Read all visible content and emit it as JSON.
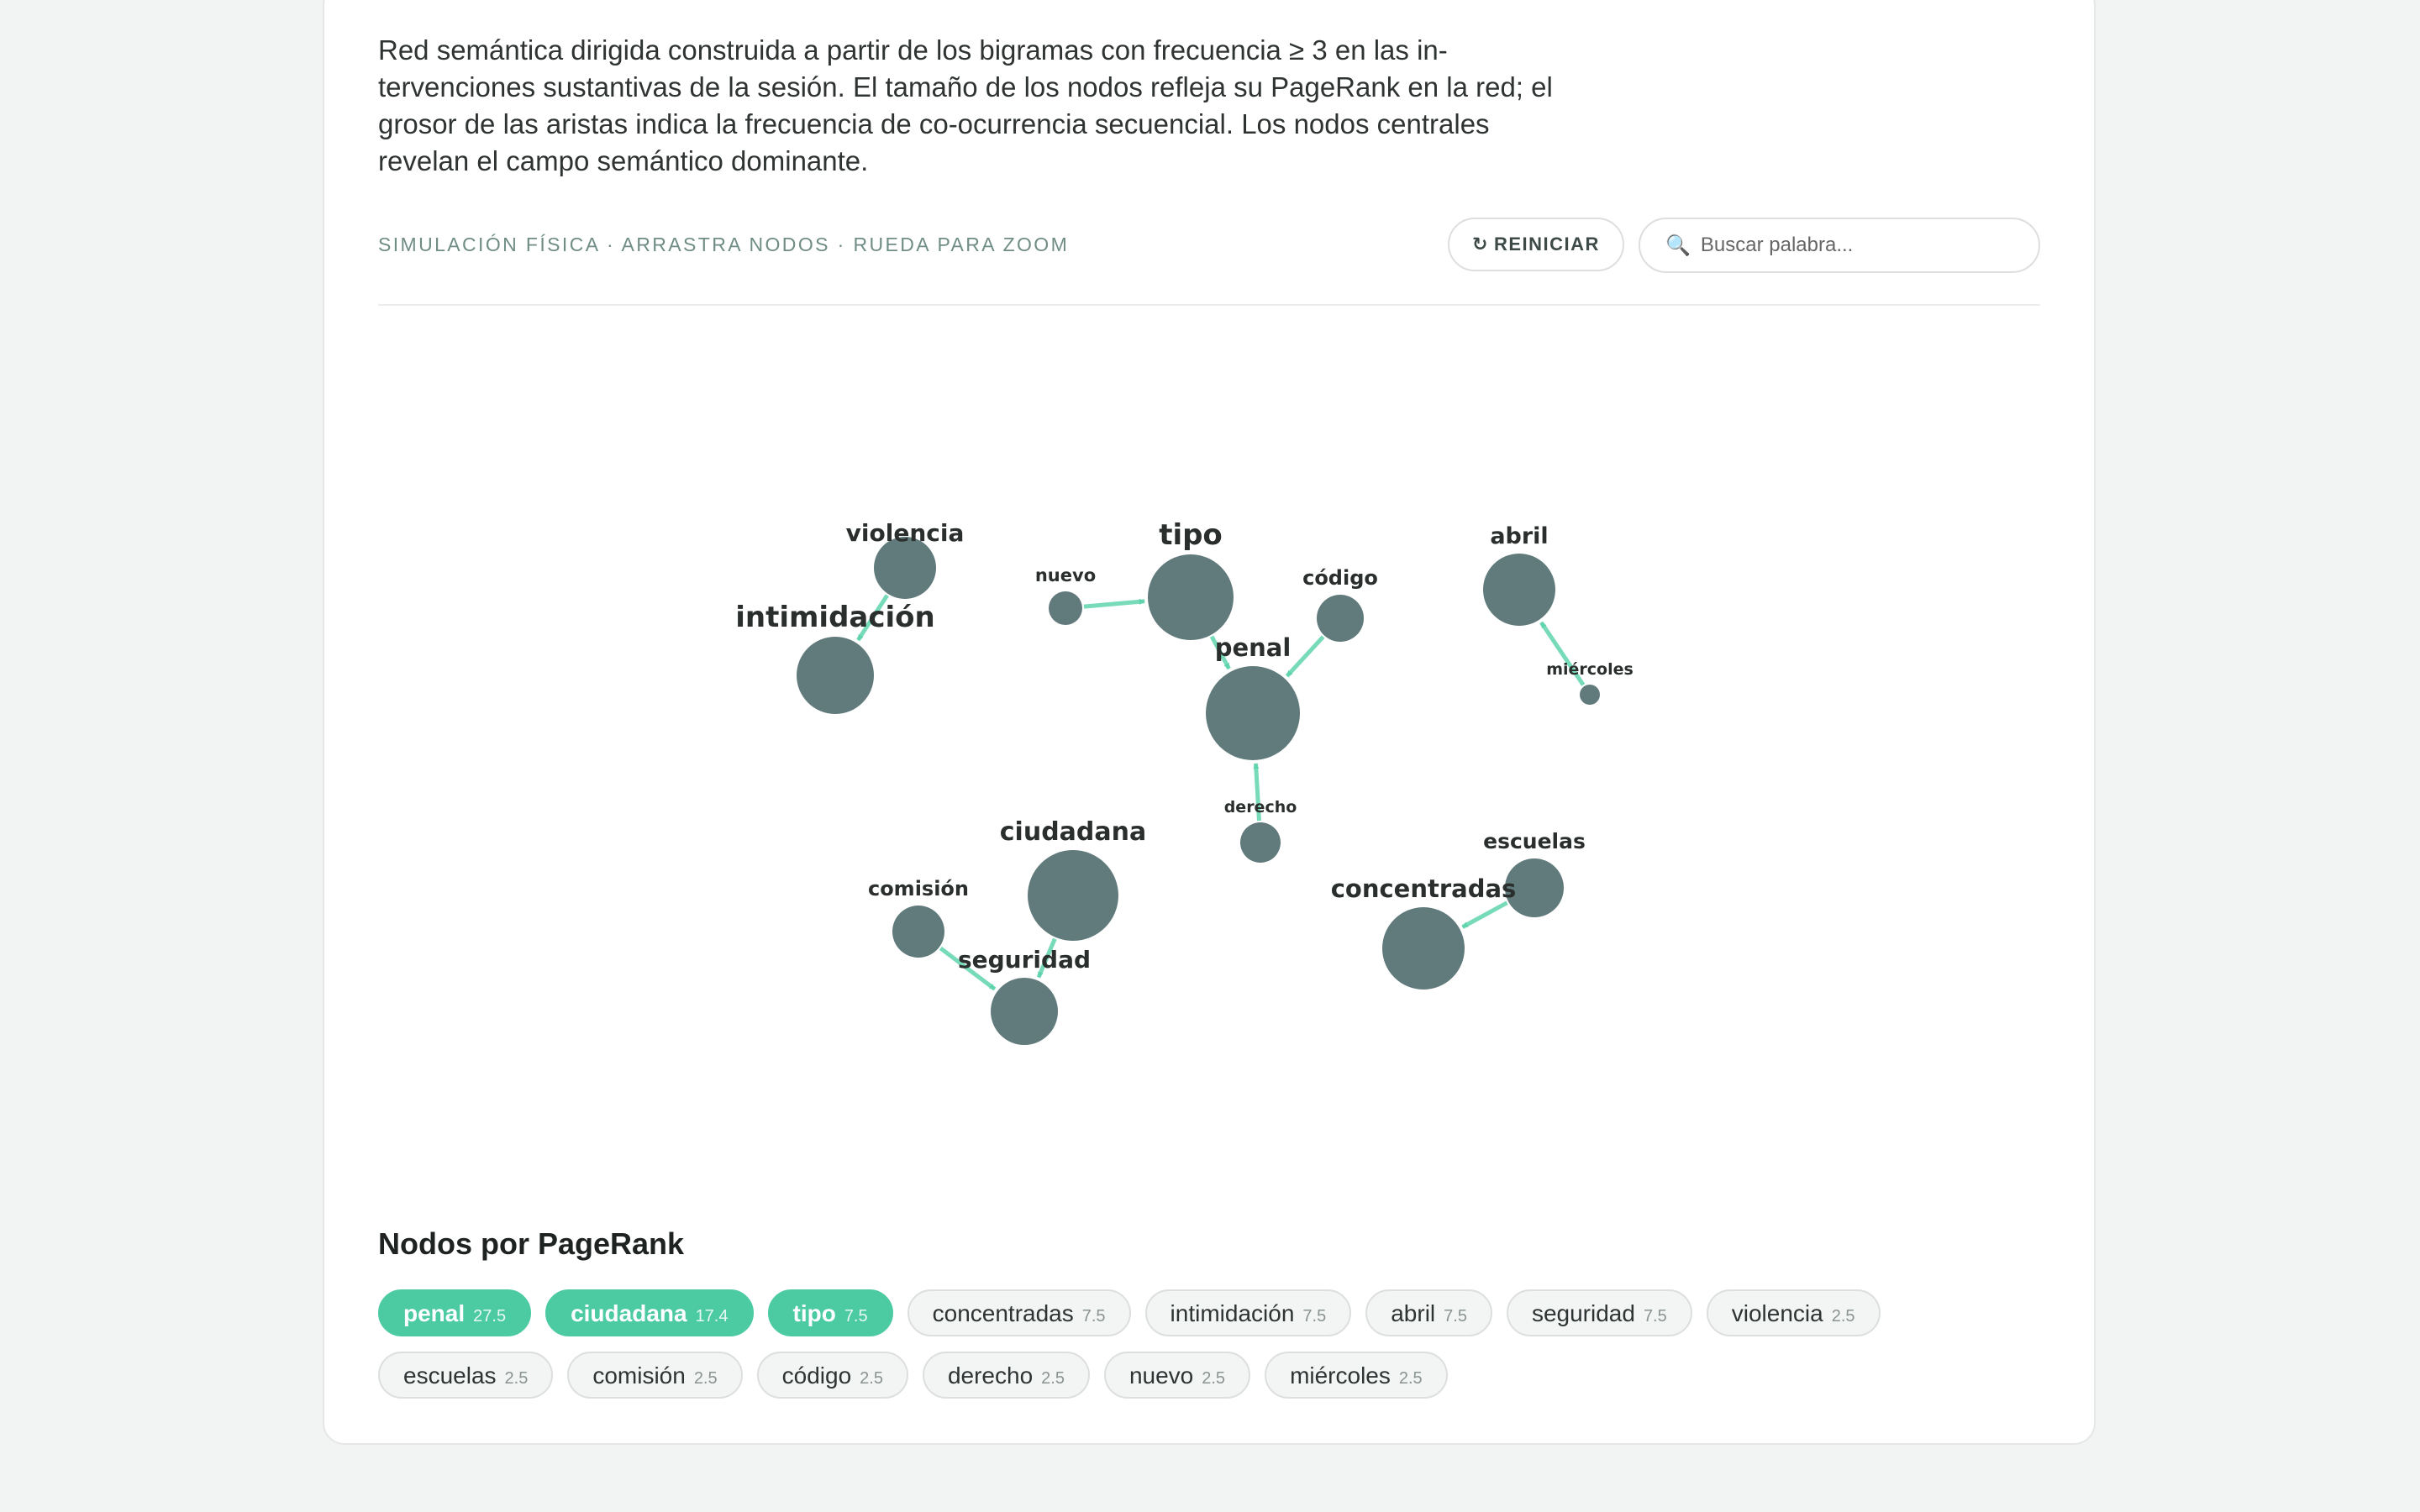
{
  "description": "Red semántica dirigida construida a partir de los bigramas con frecuencia ≥ 3 en las in­tervenciones sustantivas de la sesión. El tamaño de los nodos refleja su PageRank en la red; el grosor de las aristas indica la frecuencia de co-ocurrencia secuencial. Los nodos centrales revelan el campo semántico dominante.",
  "controls": {
    "hint": "SIMULACIÓN FÍSICA · ARRASTRA NODOS · RUEDA PARA ZOOM",
    "reset_icon": "↻",
    "reset_label": "REINICIAR",
    "search_icon": "🔍",
    "search_placeholder": "Buscar palabra..."
  },
  "colors": {
    "node": "#617a7c",
    "edge": "#5fd3ad",
    "accent": "#4ccba3"
  },
  "graph": {
    "nodes": [
      {
        "id": "penal",
        "label": "penal",
        "pagerank": 27.5
      },
      {
        "id": "ciudadana",
        "label": "ciudadana",
        "pagerank": 17.4
      },
      {
        "id": "tipo",
        "label": "tipo",
        "pagerank": 7.5
      },
      {
        "id": "concentradas",
        "label": "concentradas",
        "pagerank": 7.5
      },
      {
        "id": "intimidación",
        "label": "intimidación",
        "pagerank": 7.5
      },
      {
        "id": "abril",
        "label": "abril",
        "pagerank": 7.5
      },
      {
        "id": "seguridad",
        "label": "seguridad",
        "pagerank": 7.5
      },
      {
        "id": "violencia",
        "label": "violencia",
        "pagerank": 2.5
      },
      {
        "id": "escuelas",
        "label": "escuelas",
        "pagerank": 2.5
      },
      {
        "id": "comisión",
        "label": "comisión",
        "pagerank": 2.5
      },
      {
        "id": "código",
        "label": "código",
        "pagerank": 2.5
      },
      {
        "id": "derecho",
        "label": "derecho",
        "pagerank": 2.5
      },
      {
        "id": "nuevo",
        "label": "nuevo",
        "pagerank": 2.5
      },
      {
        "id": "miércoles",
        "label": "miércoles",
        "pagerank": 2.5
      }
    ],
    "edges": [
      {
        "source": "violencia",
        "target": "intimidación"
      },
      {
        "source": "nuevo",
        "target": "tipo"
      },
      {
        "source": "tipo",
        "target": "penal"
      },
      {
        "source": "código",
        "target": "penal"
      },
      {
        "source": "derecho",
        "target": "penal"
      },
      {
        "source": "miércoles",
        "target": "abril"
      },
      {
        "source": "comisión",
        "target": "seguridad"
      },
      {
        "source": "ciudadana",
        "target": "seguridad"
      },
      {
        "source": "escuelas",
        "target": "concentradas"
      }
    ]
  },
  "ranking": {
    "title": "Nodos por PageRank",
    "chips": [
      {
        "label": "penal",
        "score": "27.5",
        "highlight": true
      },
      {
        "label": "ciudadana",
        "score": "17.4",
        "highlight": true
      },
      {
        "label": "tipo",
        "score": "7.5",
        "highlight": true
      },
      {
        "label": "concentradas",
        "score": "7.5",
        "highlight": false
      },
      {
        "label": "intimidación",
        "score": "7.5",
        "highlight": false
      },
      {
        "label": "abril",
        "score": "7.5",
        "highlight": false
      },
      {
        "label": "seguridad",
        "score": "7.5",
        "highlight": false
      },
      {
        "label": "violencia",
        "score": "2.5",
        "highlight": false
      },
      {
        "label": "escuelas",
        "score": "2.5",
        "highlight": false
      },
      {
        "label": "comisión",
        "score": "2.5",
        "highlight": false
      },
      {
        "label": "código",
        "score": "2.5",
        "highlight": false
      },
      {
        "label": "derecho",
        "score": "2.5",
        "highlight": false
      },
      {
        "label": "nuevo",
        "score": "2.5",
        "highlight": false
      },
      {
        "label": "miércoles",
        "score": "2.5",
        "highlight": false
      }
    ]
  }
}
